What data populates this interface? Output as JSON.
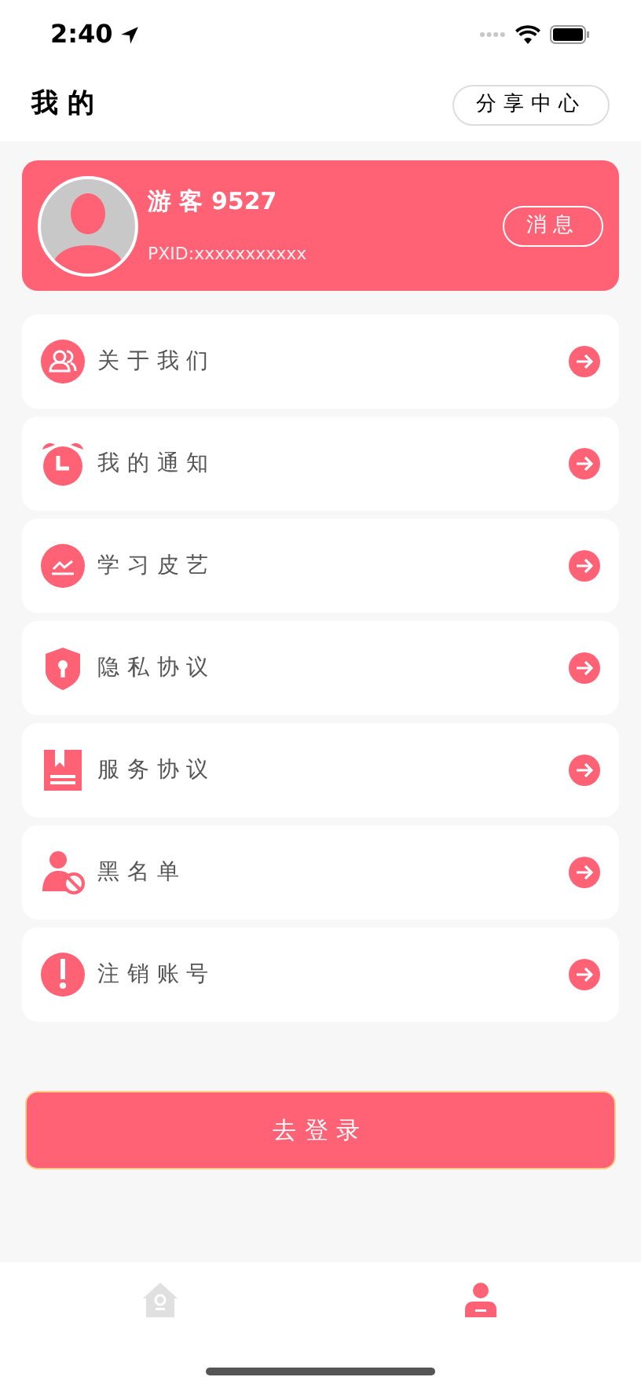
{
  "status_bar": {
    "time": "2:40"
  },
  "header": {
    "title": "我 的",
    "share_button": "分享中心"
  },
  "profile": {
    "name": "游 客 9527",
    "pxid": "PXID:xxxxxxxxxxx",
    "message_button": "消息"
  },
  "menu": [
    {
      "kind": "group",
      "label": "关于我们"
    },
    {
      "kind": "alarm",
      "label": "我的通知"
    },
    {
      "kind": "chart",
      "label": "学习皮艺"
    },
    {
      "kind": "shield",
      "label": "隐私协议"
    },
    {
      "kind": "book",
      "label": "服务协议"
    },
    {
      "kind": "block",
      "label": "黑名单"
    },
    {
      "kind": "alert",
      "label": "注销账号"
    }
  ],
  "login_button": "去登录",
  "tab_bar": [
    {
      "kind": "home",
      "selected": false
    },
    {
      "kind": "user",
      "selected": true
    }
  ]
}
